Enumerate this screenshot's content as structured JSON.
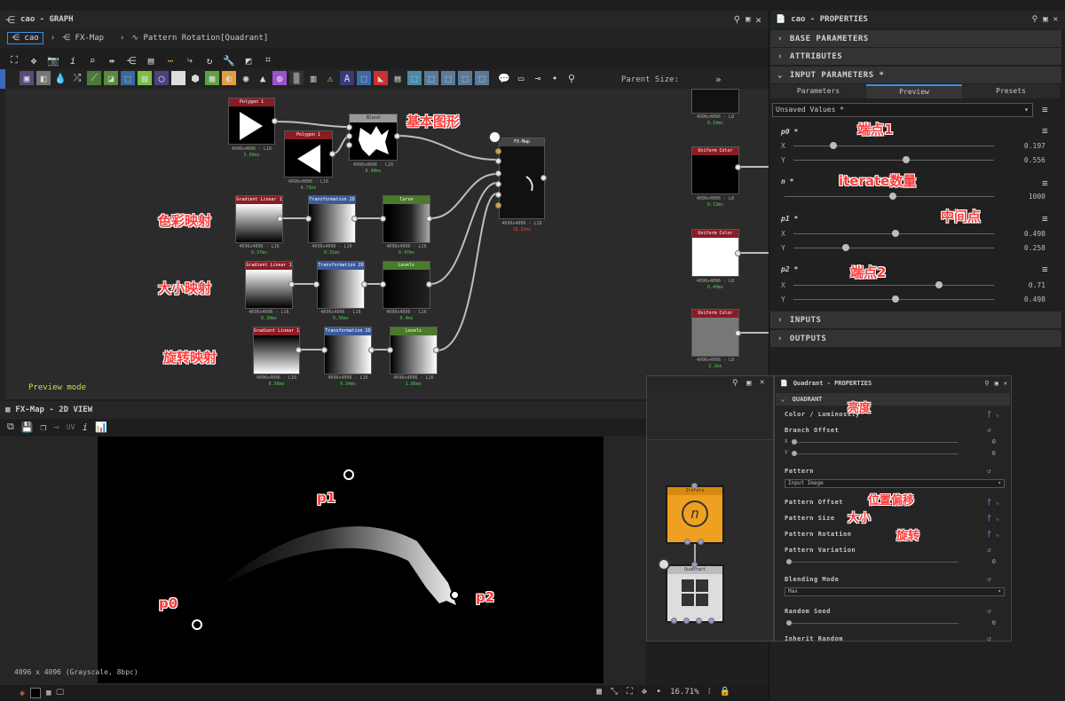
{
  "graph_panel": {
    "title": "cao - GRAPH",
    "breadcrumbs": [
      "cao",
      "FX-Map",
      "Pattern Rotation[Quadrant]"
    ],
    "parent_size_label": "Parent Size:",
    "preview_mode": "Preview mode"
  },
  "nodes": {
    "polygon1": {
      "title": "Polygon 1",
      "info": "4096x4096 - L16",
      "time": "3.99ms"
    },
    "polygon2": {
      "title": "Polygon 1",
      "info": "4096x4096 - L16",
      "time": "4.73ms"
    },
    "blend": {
      "title": "Blend",
      "info": "4096x4096 - L16",
      "time": "0.40ms"
    },
    "fxmap": {
      "title": "FX-Map",
      "info": "4096x4096 - L16",
      "time": "18.32ms"
    },
    "grad1": {
      "title": "Gradient Linear 1",
      "info": "4096x4096 - L16",
      "time": "0.37ms"
    },
    "trans1": {
      "title": "Transformation 2D",
      "info": "4096x4096 - L16",
      "time": "0.31ms"
    },
    "curve1": {
      "title": "Curve",
      "info": "4096x4096 - L16",
      "time": "0.47ms"
    },
    "grad2": {
      "title": "Gradient Linear 1",
      "info": "4096x4096 - L16",
      "time": "0.30ms"
    },
    "trans2": {
      "title": "Transformation 2D",
      "info": "4096x4096 - L16",
      "time": "0.36ms"
    },
    "levels1": {
      "title": "Levels",
      "info": "4096x4096 - L16",
      "time": "0.4ms"
    },
    "grad3": {
      "title": "Gradient Linear 1",
      "info": "4096x4096 - L16",
      "time": "0.36ms"
    },
    "trans3": {
      "title": "Transformation 2D",
      "info": "4096x4096 - L16",
      "time": "0.34ms"
    },
    "levels2": {
      "title": "Levels",
      "info": "4096x4096 - L16",
      "time": "1.86ms"
    },
    "r1": {
      "info": "4096x4096 - L8",
      "time": "0.19ms"
    },
    "r2": {
      "title": "Uniform Color",
      "info": "4096x4096 - L8",
      "time": "0.13ms"
    },
    "r3": {
      "title": "Uniform Color",
      "info": "4096x4096 - L8",
      "time": "0.49ms"
    },
    "r4": {
      "title": "Uniform Color",
      "info": "4096x4096 - L8",
      "time": "2.1ms"
    },
    "iterate": {
      "title": "Iterate"
    },
    "quadrant": {
      "title": "Quadrant"
    }
  },
  "annotations": {
    "basic_shape": "基本图形",
    "color_map": "色彩映射",
    "size_map": "大小映射",
    "rotation_map": "旋转映射",
    "endpoint1": "端点1",
    "iterate_count": "iterate数量",
    "midpoint": "中间点",
    "endpoint2": "端点2",
    "brightness": "亮度",
    "position_offset": "位置偏移",
    "size": "大小",
    "rotation": "旋转",
    "p0": "p0",
    "p1": "p1",
    "p2": "p2"
  },
  "view2d": {
    "title": "FX-Map - 2D VIEW",
    "status": "4096 x 4096 (Grayscale, 8bpc)",
    "zoom": "16.71%",
    "uv_label": "UV"
  },
  "properties": {
    "title": "cao - PROPERTIES",
    "sections": {
      "base": "BASE PARAMETERS",
      "attributes": "ATTRIBUTES",
      "input": "INPUT PARAMETERS *",
      "inputs": "INPUTS",
      "outputs": "OUTPUTS"
    },
    "tabs": [
      "Parameters",
      "Preview",
      "Presets"
    ],
    "dropdown": "Unsaved Values *",
    "params": {
      "p0": {
        "label": "p0 *",
        "x": "0.197",
        "y": "0.556"
      },
      "n": {
        "label": "n *",
        "value": "1000"
      },
      "p1": {
        "label": "p1 *",
        "x": "0.498",
        "y": "0.258"
      },
      "p2": {
        "label": "p2 *",
        "x": "0.71",
        "y": "0.498"
      }
    },
    "axis_x": "X",
    "axis_y": "Y"
  },
  "quadrant_props": {
    "title": "Quadrant - PROPERTIES",
    "section": "QUADRANT",
    "color": "Color / Luminosity",
    "branch_offset": "Branch Offset",
    "bo_x": "0",
    "bo_y": "0",
    "pattern": "Pattern",
    "pattern_value": "Input Image",
    "pattern_offset": "Pattern Offset",
    "pattern_size": "Pattern Size",
    "pattern_rotation": "Pattern Rotation",
    "pattern_variation": "Pattern Variation",
    "variation_value": "0",
    "blending": "Blending Mode",
    "blending_value": "Max",
    "random_seed": "Random Seed",
    "seed_value": "0",
    "inherit": "Inherit Random",
    "axis_x": "X",
    "axis_y": "Y"
  },
  "colors": {
    "accent": "#3a8ee6",
    "annotation": "#ff3b3b",
    "iterate": "#f0a020"
  }
}
